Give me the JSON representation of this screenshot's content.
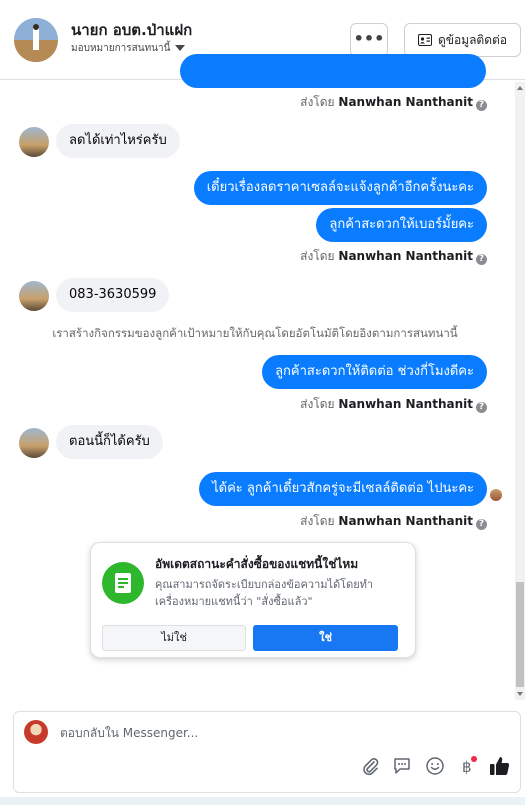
{
  "header": {
    "name": "นายก อบต.ป่าแฝก",
    "subtitle": "มอบหมายการสนทนานี้",
    "more_label": "•••",
    "contact_label": "ดูข้อมูลติดต่อ"
  },
  "messages": {
    "sent_by_prefix": "ส่งโดย",
    "sender_name": "Nanwhan Nanthanit",
    "in1": "ลดได้เท่าไหร่ครับ",
    "out1": "เดี๋ยวเรื่องลดราคาเซลล์จะแจ้งลูกค้าอีกครั้งนะคะ",
    "out2": "ลูกค้าสะดวกให้เบอร์มั้ยคะ",
    "in2": "083-3630599",
    "system_note": "เราสร้างกิจกรรมของลูกค้าเป้าหมายให้กับคุณโดยอัตโนมัติโดยอิงตามการสนทนานี้",
    "out3": "ลูกค้าสะดวกให้ติดต่อ ช่วงกี่โมงดีคะ",
    "in3": "ตอนนี้ก็ได้ครับ",
    "out4": "ได้ค่ะ ลูกค้าเดี๋ยวสักครู่จะมีเซลล์ติดต่อ ไปนะคะ"
  },
  "card": {
    "title": "อัพเดตสถานะคำสั่งซื้อของแชทนี้ใช่ไหม",
    "body": "คุณสามารถจัดระเบียบกล่องข้อความได้โดยทำเครื่องหมายแชทนี้ว่า \"สั่งซื้อแล้ว\"",
    "no_label": "ไม่ใช่",
    "yes_label": "ใช่"
  },
  "composer": {
    "placeholder": "ตอบกลับใน Messenger..."
  },
  "colors": {
    "outgoing_bubble": "#0a7cff",
    "incoming_bubble": "#f0f2f5",
    "primary_button": "#1877f2",
    "order_icon": "#2eb62c",
    "like_icon": "#1c1e21"
  },
  "icons": [
    "more-options-icon",
    "contact-card-icon",
    "info-icon",
    "order-status-icon",
    "attachment-icon",
    "saved-replies-icon",
    "emoji-icon",
    "baht-icon",
    "like-icon"
  ]
}
